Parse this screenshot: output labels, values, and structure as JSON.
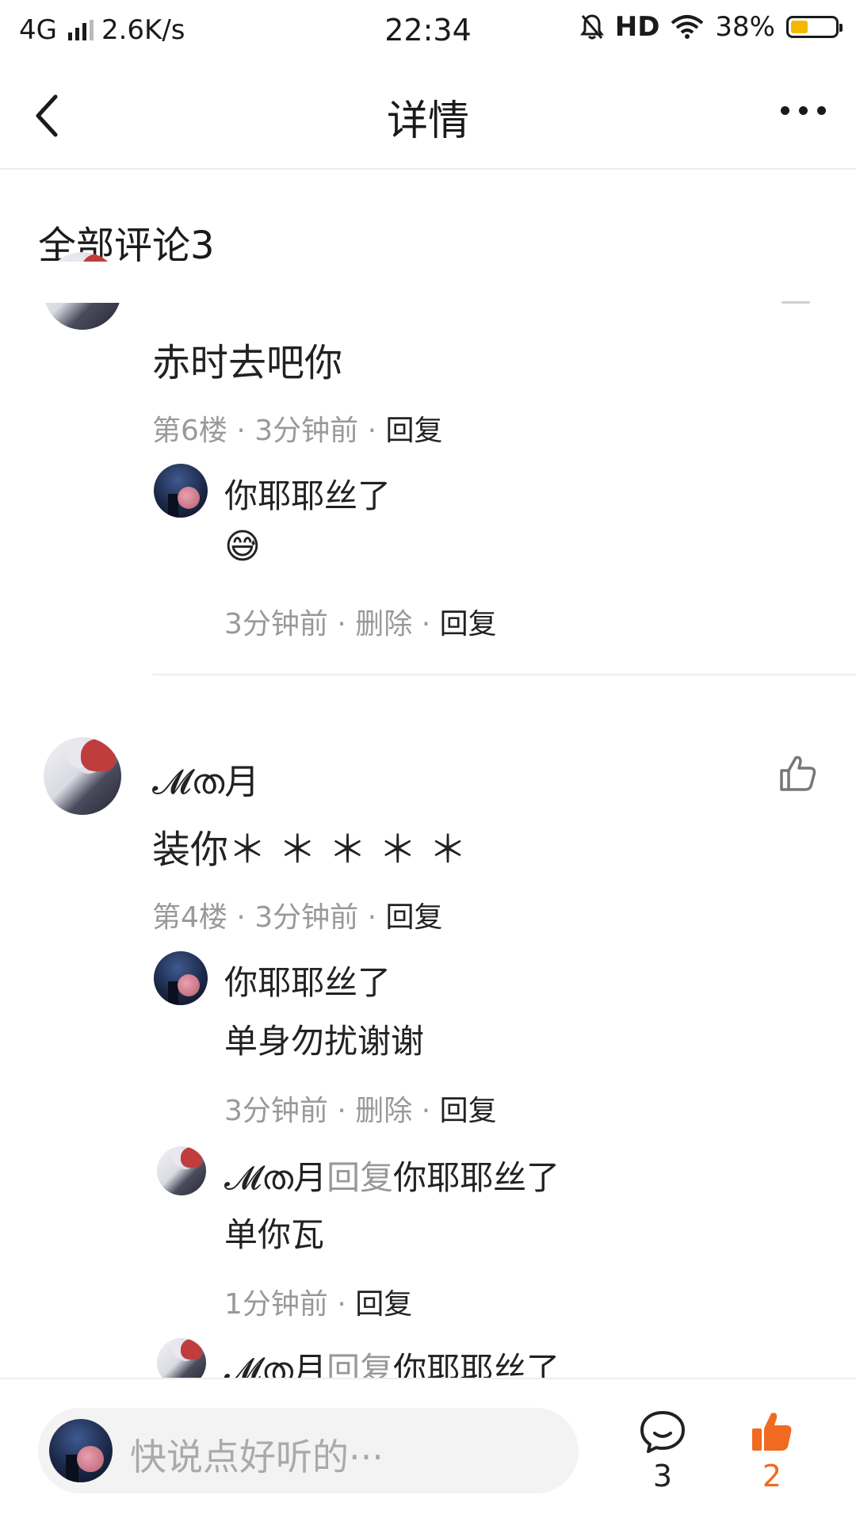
{
  "status_bar": {
    "network": "4G",
    "speed": "2.6K/s",
    "time": "22:34",
    "hd": "HD",
    "battery": "38%",
    "battery_level": 0.38
  },
  "header": {
    "title": "详情"
  },
  "section": {
    "title": "全部评论3"
  },
  "comments": [
    {
      "content": "赤时去吧你",
      "floor": "第6楼",
      "time": "3分钟前",
      "reply_label": "回复",
      "replies": [
        {
          "user": "你耶耶丝了",
          "text": "😅",
          "time": "3分钟前",
          "delete_label": "删除",
          "reply_label": "回复"
        }
      ]
    },
    {
      "user": "𝓜ത月",
      "content": "装你＊ ＊ ＊ ＊ ＊",
      "floor": "第4楼",
      "time": "3分钟前",
      "reply_label": "回复",
      "replies": [
        {
          "user": "你耶耶丝了",
          "text": "单身勿扰谢谢",
          "time": "3分钟前",
          "delete_label": "删除",
          "reply_label": "回复"
        },
        {
          "user": "𝓜ത月",
          "reply_word": "回复",
          "target": "你耶耶丝了",
          "text": "单你瓦",
          "time": "1分钟前",
          "reply_label": "回复"
        },
        {
          "user": "𝓜ത月",
          "reply_word": "回复",
          "target": "你耶耶丝了"
        }
      ]
    }
  ],
  "bottom_bar": {
    "placeholder": "快说点好听的···",
    "comment_count": "3",
    "like_count": "2"
  },
  "colors": {
    "accent": "#f06a1f",
    "muted": "#999999",
    "text": "#222222",
    "battery_fill": "#f5b800"
  },
  "icons": [
    "back-arrow-icon",
    "more-icon",
    "thumbs-up-icon",
    "comment-bubble-icon",
    "thumbs-up-filled-icon",
    "wifi-icon",
    "bell-off-icon"
  ]
}
